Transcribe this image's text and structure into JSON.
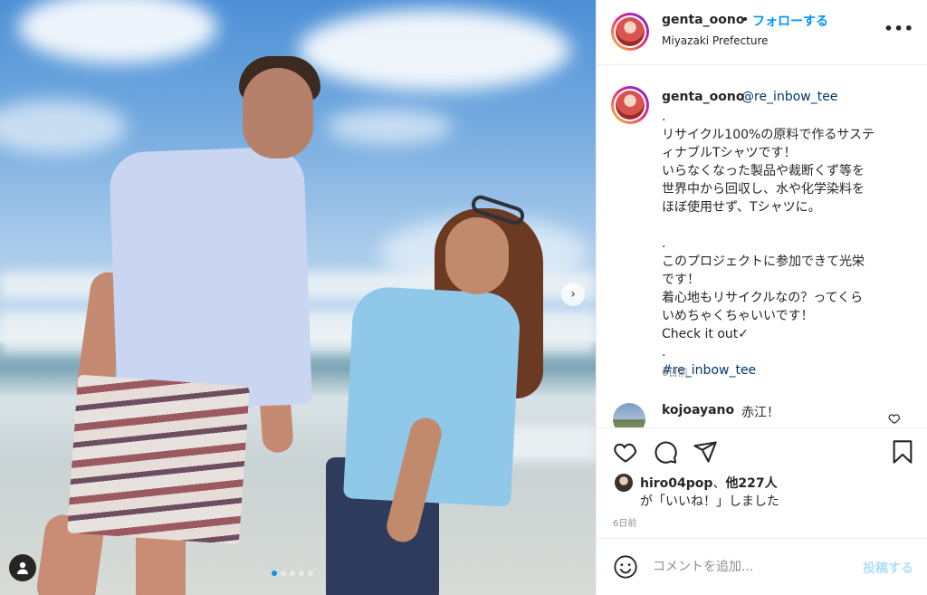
{
  "post": {
    "username": "genta_oono",
    "separator": "•",
    "follow_label": "フォローする",
    "location": "Miyazaki Prefecture",
    "more_label": "•••"
  },
  "caption": {
    "username": "genta_oono",
    "mention": "@re_inbow_tee",
    "lines": [
      ".",
      "リサイクル100%の原料で作るサステ",
      "ィナブルTシャツです！",
      "いらなくなった製品や裁断くず等を",
      "世界中から回収し、水や化学染料を",
      "ほぼ使用せず、Tシャツに。",
      "",
      ".",
      "このプロジェクトに参加できて光栄",
      "です！",
      "着心地もリサイクルなの？ってくら",
      "いめちゃくちゃいいです！",
      "Check it out✓",
      "."
    ],
    "hashtag": "#re_inbow_tee",
    "time": "6日前"
  },
  "comment": {
    "username": "kojoayano",
    "text": "赤江！"
  },
  "likes": {
    "user": "hiro04pop",
    "others": "他227人",
    "connector": "、",
    "line2": "が「いいね！」しました"
  },
  "post_time": "6日前",
  "comment_input": {
    "placeholder": "コメントを追加...",
    "post_label": "投稿する"
  },
  "carousel": {
    "next_icon": "chevron-right-icon",
    "current_index": 0,
    "total": 5
  },
  "colors": {
    "link": "#0095f6",
    "mention": "#00376b",
    "muted": "#8e8e8e",
    "post_disabled": "#b2dffc"
  }
}
